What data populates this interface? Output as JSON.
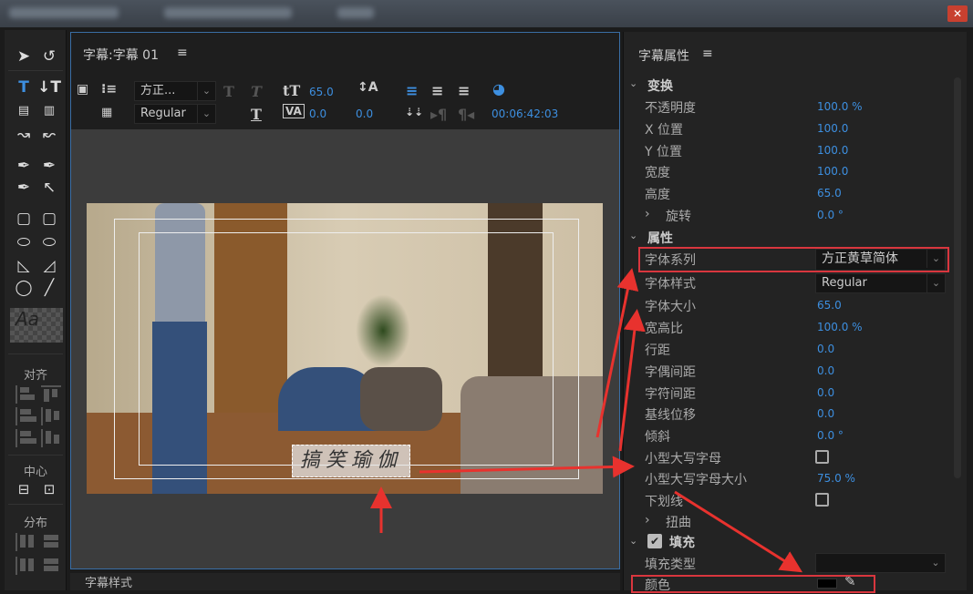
{
  "window": {
    "close_icon": "close-icon"
  },
  "tools_panel": {
    "align_label": "对齐",
    "center_label": "中心",
    "distribute_label": "分布"
  },
  "editor": {
    "title": "字幕:字幕 01",
    "menu_icon": "≡",
    "font_family": "方正...",
    "font_style": "Regular",
    "font_size": "65.0",
    "leading": "0.0",
    "kerning": "0.0",
    "tracking": "0.0",
    "timecode": "00:06:42:03",
    "caption_text": "搞笑瑜伽"
  },
  "properties": {
    "title": "字幕属性",
    "menu_icon": "≡",
    "transform": {
      "label": "变换",
      "rows": [
        {
          "label": "不透明度",
          "value": "100.0 %"
        },
        {
          "label": "X 位置",
          "value": "100.0"
        },
        {
          "label": "Y 位置",
          "value": "100.0"
        },
        {
          "label": "宽度",
          "value": "100.0"
        },
        {
          "label": "高度",
          "value": "65.0"
        },
        {
          "label": "旋转",
          "value": "0.0 °"
        }
      ]
    },
    "attributes": {
      "label": "属性",
      "font_family_label": "字体系列",
      "font_family_value": "方正黄草简体",
      "font_style_label": "字体样式",
      "font_style_value": "Regular",
      "rows": [
        {
          "label": "字体大小",
          "value": "65.0"
        },
        {
          "label": "宽高比",
          "value": "100.0 %"
        },
        {
          "label": "行距",
          "value": "0.0"
        },
        {
          "label": "字偶间距",
          "value": "0.0"
        },
        {
          "label": "字符间距",
          "value": "0.0"
        },
        {
          "label": "基线位移",
          "value": "0.0"
        },
        {
          "label": "倾斜",
          "value": "0.0 °"
        }
      ],
      "small_caps_label": "小型大写字母",
      "small_caps_checked": false,
      "small_caps_size_label": "小型大写字母大小",
      "small_caps_size_value": "75.0 %",
      "underline_label": "下划线",
      "underline_checked": false,
      "distort_label": "扭曲"
    },
    "fill": {
      "label": "填充",
      "checked": true,
      "fill_type_label": "填充类型",
      "fill_type_value": "",
      "color_label": "颜色",
      "color_value": "#000000"
    }
  },
  "bottom_tab": {
    "label": "字幕样式"
  },
  "colors": {
    "accent": "#3d8fe0",
    "highlight": "#d9363e"
  }
}
